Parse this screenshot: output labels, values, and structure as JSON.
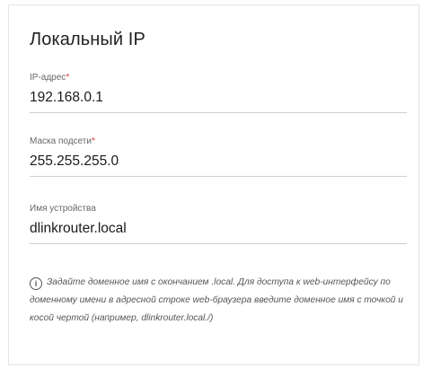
{
  "section": {
    "title": "Локальный IP"
  },
  "fields": {
    "ip": {
      "label": "IP-адрес",
      "required_mark": "*",
      "value": "192.168.0.1"
    },
    "mask": {
      "label": "Маска подсети",
      "required_mark": "*",
      "value": "255.255.255.0"
    },
    "device_name": {
      "label": "Имя устройства",
      "value": "dlinkrouter.local"
    }
  },
  "hint": {
    "icon": "info-icon",
    "text": "Задайте доменное имя с окончанием .local. Для доступа к web-интерфейсу по доменному имени в адресной строке web-браузера введите доменное имя с точкой и косой чертой (например, dlinkrouter.local./)"
  }
}
